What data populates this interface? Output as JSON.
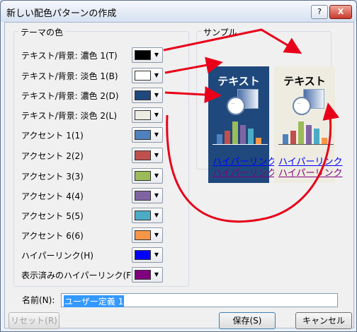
{
  "window": {
    "title": "新しい配色パターンの作成",
    "help_label": "?",
    "close_label": "X"
  },
  "theme_colors": {
    "legend": "テーマの色",
    "items": [
      {
        "label": "テキスト/背景: 濃色 1(T)",
        "color": "#000000"
      },
      {
        "label": "テキスト/背景: 淡色 1(B)",
        "color": "#FFFFFF"
      },
      {
        "label": "テキスト/背景: 濃色 2(D)",
        "color": "#1F497D"
      },
      {
        "label": "テキスト/背景: 淡色 2(L)",
        "color": "#EEECE1"
      },
      {
        "label": "アクセント 1(1)",
        "color": "#4F81BD"
      },
      {
        "label": "アクセント 2(2)",
        "color": "#C0504D"
      },
      {
        "label": "アクセント 3(3)",
        "color": "#9BBB59"
      },
      {
        "label": "アクセント 4(4)",
        "color": "#8064A2"
      },
      {
        "label": "アクセント 5(5)",
        "color": "#4BACC6"
      },
      {
        "label": "アクセント 6(6)",
        "color": "#F79646"
      },
      {
        "label": "ハイパーリンク(H)",
        "color": "#0000FF"
      },
      {
        "label": "表示済みのハイパーリンク(F)",
        "color": "#800080"
      }
    ]
  },
  "sample": {
    "legend": "サンプル",
    "heading": "テキスト",
    "hyperlink": "ハイパーリンク",
    "followed_hyperlink": "ハイパーリンク",
    "bar_values": [
      0.45,
      0.6,
      1.0,
      0.85,
      0.7,
      0.3
    ]
  },
  "name": {
    "label": "名前(N):",
    "value": "ユーザー定義 1"
  },
  "buttons": {
    "reset": "リセット(R)",
    "save": "保存(S)",
    "cancel": "キャンセル"
  },
  "annotation_color": "#E8001A"
}
